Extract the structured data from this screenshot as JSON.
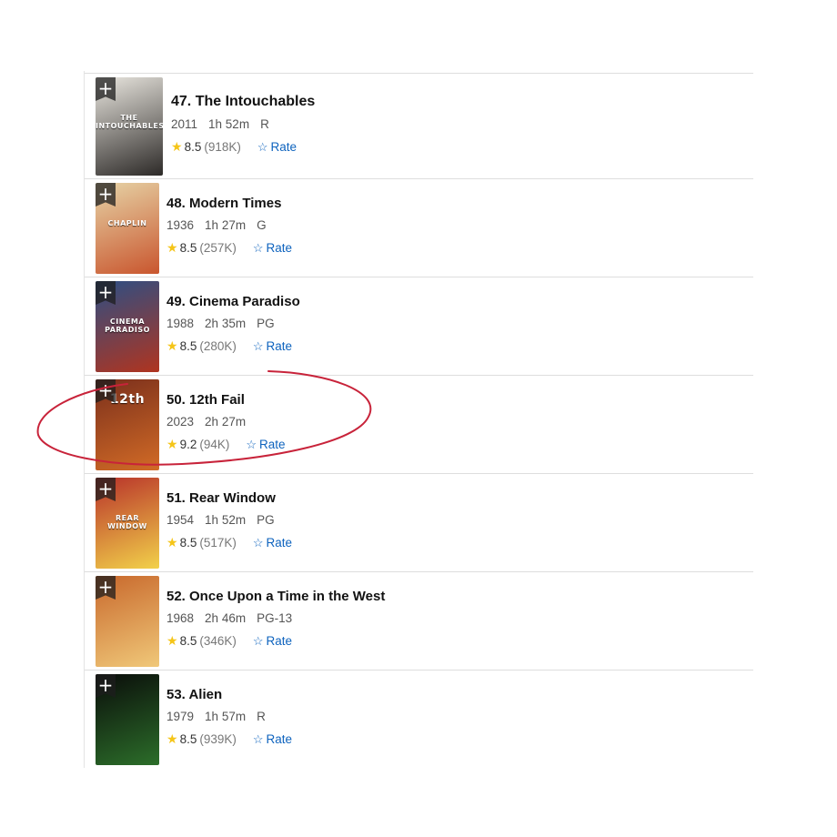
{
  "list": {
    "items": [
      {
        "rank_title": "47. The Intouchables",
        "year": "2011",
        "runtime": "1h 52m",
        "certificate": "R",
        "rating": "8.5",
        "votes": "(918K)",
        "rate_label": "Rate",
        "add_glyph": "+",
        "poster_caption": "THE INTOUCHABLES",
        "poster_colors": [
          "#e9e6df",
          "#2d2a28"
        ]
      },
      {
        "rank_title": "48. Modern Times",
        "year": "1936",
        "runtime": "1h 27m",
        "certificate": "G",
        "rating": "8.5",
        "votes": "(257K)",
        "rate_label": "Rate",
        "add_glyph": "+",
        "poster_caption": "CHAPLIN",
        "poster_colors": [
          "#e6d3a6",
          "#c9562e"
        ]
      },
      {
        "rank_title": "49. Cinema Paradiso",
        "year": "1988",
        "runtime": "2h 35m",
        "certificate": "PG",
        "rating": "8.5",
        "votes": "(280K)",
        "rate_label": "Rate",
        "add_glyph": "+",
        "poster_caption": "CINEMA PARADISO",
        "poster_colors": [
          "#2d4f84",
          "#b0341f"
        ]
      },
      {
        "rank_title": "50. 12th Fail",
        "year": "2023",
        "runtime": "2h 27m",
        "certificate": "",
        "rating": "9.2",
        "votes": "(94K)",
        "rate_label": "Rate",
        "add_glyph": "+",
        "poster_caption": "12th",
        "poster_colors": [
          "#7a2f1c",
          "#d26b26"
        ]
      },
      {
        "rank_title": "51. Rear Window",
        "year": "1954",
        "runtime": "1h 52m",
        "certificate": "PG",
        "rating": "8.5",
        "votes": "(517K)",
        "rate_label": "Rate",
        "add_glyph": "+",
        "poster_caption": "REAR WINDOW",
        "poster_colors": [
          "#b8322a",
          "#f2d14a"
        ]
      },
      {
        "rank_title": "52. Once Upon a Time in the West",
        "year": "1968",
        "runtime": "2h 46m",
        "certificate": "PG-13",
        "rating": "8.5",
        "votes": "(346K)",
        "rate_label": "Rate",
        "add_glyph": "+",
        "poster_caption": "",
        "poster_colors": [
          "#c8682c",
          "#f0c879"
        ]
      },
      {
        "rank_title": "53. Alien",
        "year": "1979",
        "runtime": "1h 57m",
        "certificate": "R",
        "rating": "8.5",
        "votes": "(939K)",
        "rate_label": "Rate",
        "add_glyph": "+",
        "poster_caption": "",
        "poster_colors": [
          "#0a0c0a",
          "#2c6e2a"
        ]
      }
    ]
  },
  "icons": {
    "star": "star-icon",
    "rate": "outline-star-icon",
    "add": "plus-icon"
  },
  "colors": {
    "accent_blue": "#0e63be",
    "star_gold": "#f5c518",
    "annotation_red": "#c8233a"
  }
}
